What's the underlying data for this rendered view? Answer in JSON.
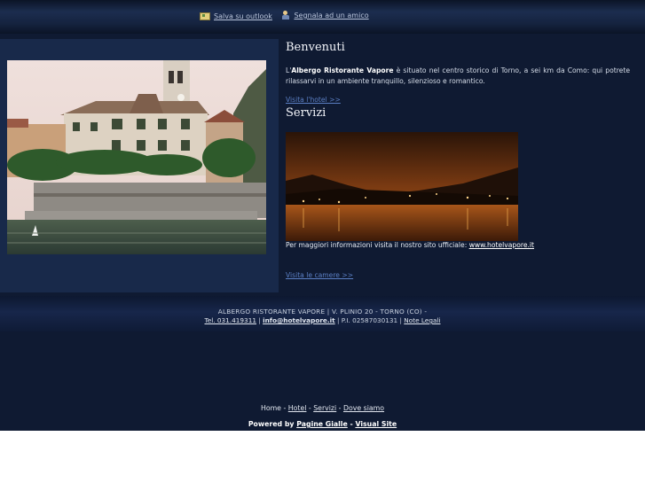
{
  "top_links": {
    "save_outlook": "Salva su outlook",
    "recommend": "Segnala ad un amico"
  },
  "welcome": {
    "heading": "Benvenuti",
    "intro_prefix": "L'",
    "hotel_name": "Albergo Ristorante Vapore",
    "intro_rest": " è situato nel centro storico di Torno, a sei km da Como: qui potrete rilassarvi in un ambiente tranquillo, silenzioso e romantico.",
    "visit_link": "Visita l'hotel >>"
  },
  "services": {
    "heading": "Servizi",
    "info_text": "Per maggiori informazioni visita il nostro sito ufficiale: ",
    "site_link": "www.hotelvapore.it",
    "rooms_link": "Visita le camere >>"
  },
  "footer": {
    "address": "ALBERGO RISTORANTE VAPORE | V. PLINIO 20 - TORNO (CO) -",
    "phone": "Tel. 031.419311",
    "sep1": " | ",
    "email": "info@hotelvapore.it",
    "vat": " | P.I. 02587030131 | ",
    "legal": "Note Legali"
  },
  "bottom_nav": {
    "home": "Home",
    "sep": " - ",
    "hotel": "Hotel",
    "services": "Servizi",
    "where": "Dove siamo"
  },
  "powered": {
    "prefix": "Powered by  ",
    "pagine_gialle": "Pagine Gialle",
    "sep": " - ",
    "visual_site": "Visual Site"
  },
  "colors": {
    "background": "#0f1a32",
    "panel": "#18294a",
    "link": "#5b7fc4"
  },
  "icons": [
    "outlook-icon",
    "recommend-icon"
  ]
}
